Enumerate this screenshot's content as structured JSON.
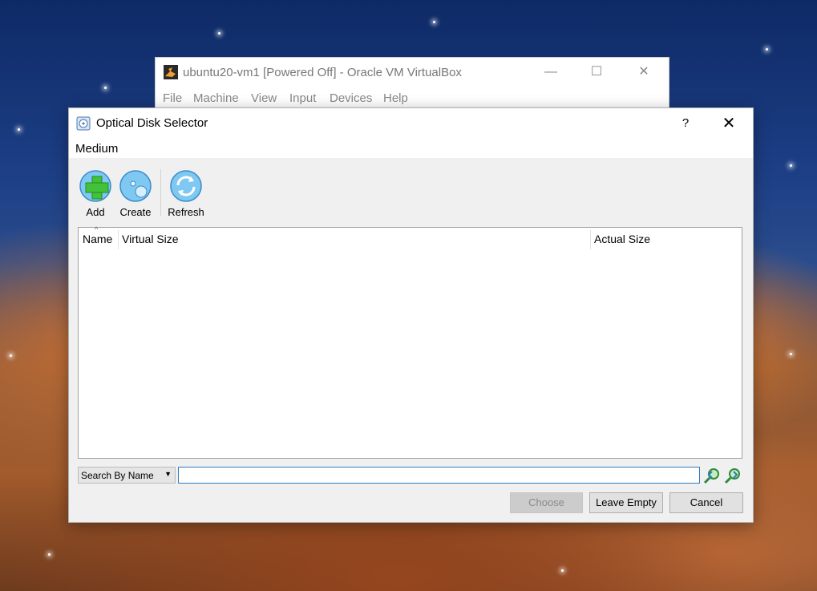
{
  "background_window": {
    "title": "ubuntu20-vm1 [Powered Off] - Oracle VM VirtualBox",
    "menu": [
      "File",
      "Machine",
      "View",
      "Input",
      "Devices",
      "Help"
    ],
    "minimize_glyph": "—",
    "maximize_glyph": "☐",
    "close_glyph": "✕"
  },
  "dialog": {
    "title": "Optical Disk Selector",
    "help_glyph": "?",
    "close_glyph": "✕",
    "menu": [
      "Medium"
    ],
    "toolbar": [
      {
        "label": "Add",
        "icon": "add-icon"
      },
      {
        "label": "Create",
        "icon": "create-disc-icon"
      },
      {
        "label": "Refresh",
        "icon": "refresh-icon"
      }
    ],
    "table": {
      "columns": [
        "Name",
        "Virtual Size",
        "Actual Size"
      ],
      "sort_indicator": "^",
      "rows": []
    },
    "search": {
      "mode": "Search By Name",
      "dropdown_glyph": "▼",
      "value": "",
      "placeholder": ""
    },
    "buttons": {
      "choose": "Choose",
      "leave_empty": "Leave Empty",
      "cancel": "Cancel"
    }
  },
  "colors": {
    "accent": "#2f79c2",
    "dialog_bg": "#f0f0f0",
    "disabled_text": "#8a8a8a"
  }
}
